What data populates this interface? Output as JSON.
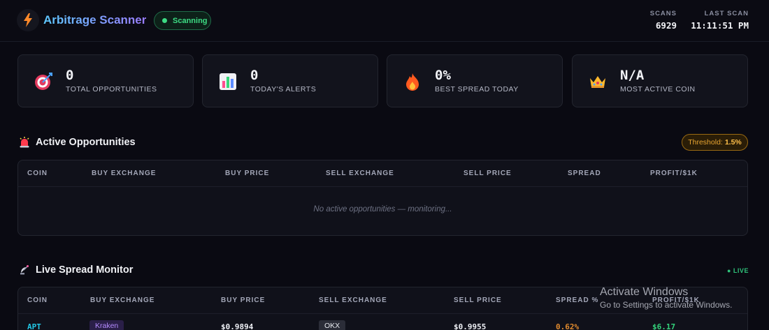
{
  "header": {
    "title": "Arbitrage Scanner",
    "status": "Scanning",
    "scans_label": "SCANS",
    "scans_value": "6929",
    "last_scan_label": "LAST SCAN",
    "last_scan_value": "11:11:51 PM",
    "logo_icon": "lightning-bolt-icon"
  },
  "stats": [
    {
      "value": "0",
      "label": "TOTAL OPPORTUNITIES",
      "icon": "target-icon"
    },
    {
      "value": "0",
      "label": "TODAY'S ALERTS",
      "icon": "bar-chart-icon"
    },
    {
      "value": "0%",
      "label": "BEST SPREAD TODAY",
      "icon": "fire-icon"
    },
    {
      "value": "N/A",
      "label": "MOST ACTIVE COIN",
      "icon": "crown-icon"
    }
  ],
  "opportunities": {
    "title": "Active Opportunities",
    "icon": "siren-icon",
    "threshold_label": "Threshold:",
    "threshold_value": "1.5%",
    "columns": [
      "COIN",
      "BUY EXCHANGE",
      "BUY PRICE",
      "SELL EXCHANGE",
      "SELL PRICE",
      "SPREAD",
      "PROFIT/$1K"
    ],
    "empty_message": "No active opportunities — monitoring..."
  },
  "monitor": {
    "title": "Live Spread Monitor",
    "icon": "satellite-icon",
    "live_label": "● LIVE",
    "columns": [
      "COIN",
      "BUY EXCHANGE",
      "BUY PRICE",
      "SELL EXCHANGE",
      "SELL PRICE",
      "SPREAD %",
      "PROFIT/$1K"
    ],
    "rows": [
      {
        "coin": "APT",
        "buy_exchange": "Kraken",
        "buy_price": "$0.9894",
        "sell_exchange": "OKX",
        "sell_price": "$0.9955",
        "spread": "0.62%",
        "profit": "$6.17"
      }
    ]
  },
  "watermark": {
    "line1": "Activate Windows",
    "line2": "Go to Settings to activate Windows."
  },
  "colors": {
    "background": "#0a0a12",
    "accent_green": "#3ddc84",
    "accent_amber": "#e9a531",
    "coin_cyan": "#22c8e6",
    "kraken_purple": "#b58cff",
    "spread_orange": "#e08a2e",
    "profit_green": "#33d17a"
  }
}
